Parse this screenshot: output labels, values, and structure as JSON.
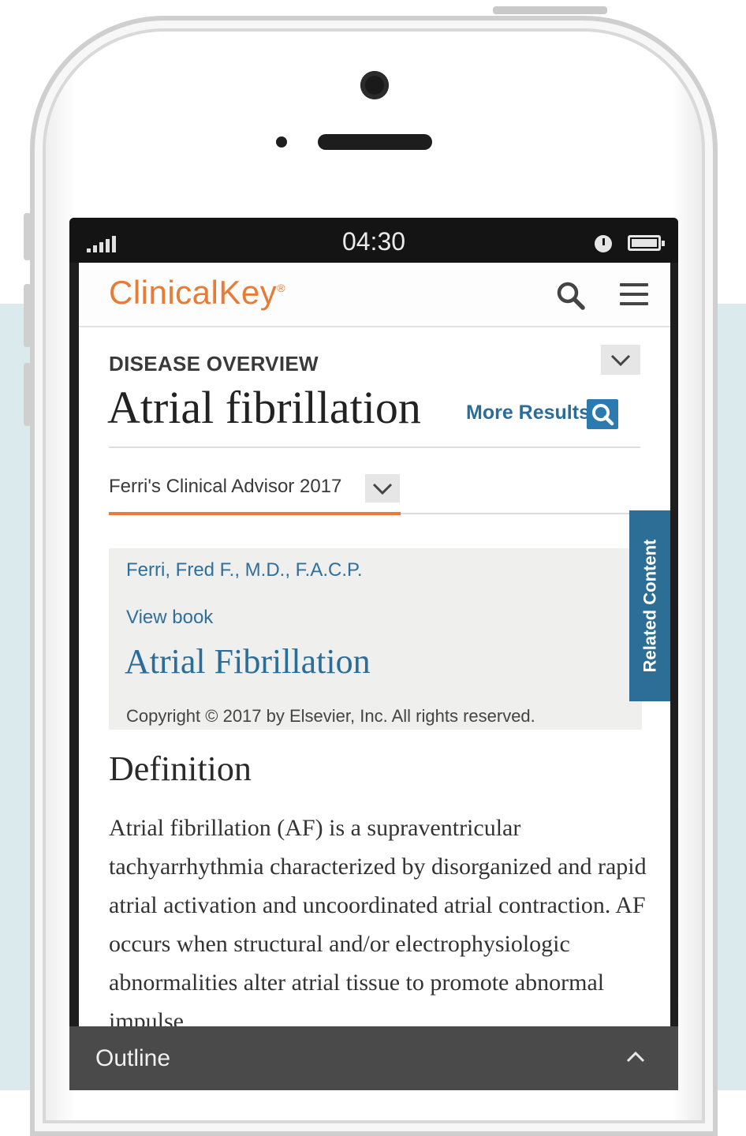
{
  "status_bar": {
    "time": "04:30"
  },
  "header": {
    "logo_text": "ClinicalKey",
    "logo_mark": "®"
  },
  "article": {
    "section_label": "DISEASE OVERVIEW",
    "title": "Atrial fibrillation",
    "more_results": "More Results"
  },
  "source": {
    "selected": "Ferri's Clinical Advisor 2017"
  },
  "related_tab": {
    "label": "Related Content"
  },
  "book_card": {
    "author": "Ferri, Fred F., M.D., F.A.C.P.",
    "view_book": "View book",
    "chapter_title": "Atrial Fibrillation",
    "copyright": "Copyright © 2017 by Elsevier, Inc. All rights reserved."
  },
  "definition": {
    "heading": "Definition",
    "body": "Atrial fibrillation (AF) is a supraventricular tachyarrhythmia characterized by disorganized and rapid atrial activation and uncoordinated atrial contraction. AF occurs when structural and/or electrophysiologic abnormalities alter atrial tissue to promote abnormal impulse"
  },
  "outline_bar": {
    "label": "Outline"
  },
  "colors": {
    "brand_orange": "#e87b35",
    "link_blue": "#2f6f9c",
    "related_tab_blue": "#2d6e96"
  },
  "icons": [
    "signal-icon",
    "clock-icon",
    "battery-icon",
    "search-icon",
    "hamburger-menu-icon",
    "chevron-down-icon",
    "chevron-up-icon"
  ]
}
